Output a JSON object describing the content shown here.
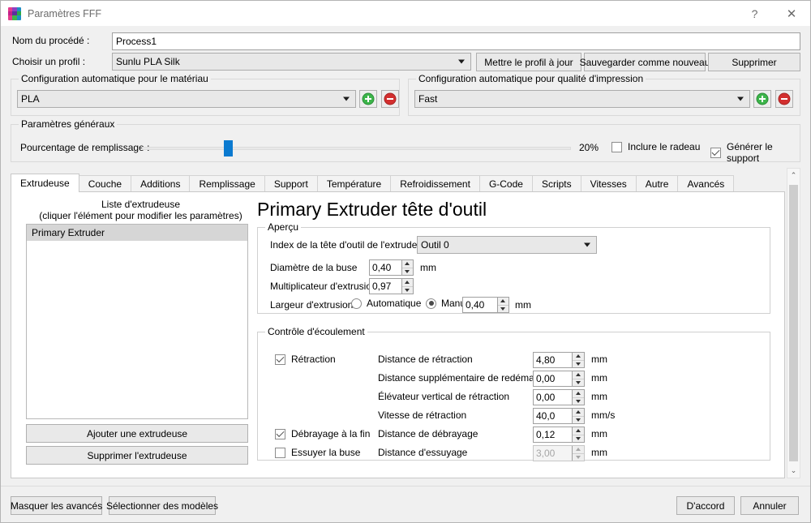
{
  "window": {
    "title": "Paramètres FFF",
    "help_label": "?",
    "close_label": "✕",
    "icon": "fff-settings-icon"
  },
  "top": {
    "process_name_label": "Nom du procédé :",
    "process_name_value": "Process1",
    "profile_label": "Choisir un profil :",
    "profile_value": "Sunlu PLA Silk",
    "update_profile_button": "Mettre le profil à jour",
    "save_as_new_button": "Sauvegarder comme nouveau",
    "delete_button": "Supprimer"
  },
  "material_group": {
    "title": "Configuration automatique pour le matériau",
    "value": "PLA",
    "add_label": "+",
    "remove_label": "−"
  },
  "quality_group": {
    "title": "Configuration automatique pour qualité d'impression",
    "value": "Fast",
    "add_label": "+",
    "remove_label": "−"
  },
  "general_group": {
    "title": "Paramètres généraux",
    "infill_label": "Pourcentage de remplissage :",
    "infill_value": "20%",
    "infill_percent": 20,
    "raft_label": "Inclure le radeau",
    "raft_checked": false,
    "support_label": "Générer le support",
    "support_checked": true
  },
  "tabs": [
    {
      "label": "Extrudeuse",
      "active": true
    },
    {
      "label": "Couche",
      "active": false
    },
    {
      "label": "Additions",
      "active": false
    },
    {
      "label": "Remplissage",
      "active": false
    },
    {
      "label": "Support",
      "active": false
    },
    {
      "label": "Température",
      "active": false
    },
    {
      "label": "Refroidissement",
      "active": false
    },
    {
      "label": "G-Code",
      "active": false
    },
    {
      "label": "Scripts",
      "active": false
    },
    {
      "label": "Vitesses",
      "active": false
    },
    {
      "label": "Autre",
      "active": false
    },
    {
      "label": "Avancés",
      "active": false
    }
  ],
  "extruder_list": {
    "title_line1": "Liste d'extrudeuse",
    "title_line2": "(cliquer l'élément pour modifier les paramètres)",
    "items": [
      "Primary Extruder"
    ],
    "selected": "Primary Extruder",
    "add_button": "Ajouter une extrudeuse",
    "remove_button": "Supprimer l'extrudeuse"
  },
  "panel": {
    "heading": "Primary Extruder tête d'outil",
    "overview": {
      "title": "Aperçu",
      "tool_index_label": "Index de la tête d'outil de l'extrudeuse",
      "tool_index_value": "Outil 0",
      "nozzle_diameter_label": "Diamètre de la buse",
      "nozzle_diameter_value": "0,40",
      "nozzle_diameter_unit": "mm",
      "extrusion_multiplier_label": "Multiplicateur d'extrusion",
      "extrusion_multiplier_value": "0,97",
      "extrusion_width_label": "Largeur d'extrusion",
      "extrusion_width_auto_label": "Automatique",
      "extrusion_width_manual_label": "Manuel",
      "extrusion_width_mode": "manuel",
      "extrusion_width_value": "0,40",
      "extrusion_width_unit": "mm"
    },
    "flow": {
      "title": "Contrôle d'écoulement",
      "retraction_label": "Rétraction",
      "retraction_checked": true,
      "coast_label": "Débrayage à la fin",
      "coast_checked": true,
      "wipe_label": "Essuyer la buse",
      "wipe_checked": false,
      "rows": [
        {
          "label": "Distance de rétraction",
          "value": "4,80",
          "unit": "mm",
          "disabled": false
        },
        {
          "label": "Distance supplémentaire de redémarrage",
          "value": "0,00",
          "unit": "mm",
          "disabled": false
        },
        {
          "label": "Élévateur vertical de rétraction",
          "value": "0,00",
          "unit": "mm",
          "disabled": false
        },
        {
          "label": "Vitesse de rétraction",
          "value": "40,0",
          "unit": "mm/s",
          "disabled": false
        },
        {
          "label": "Distance de débrayage",
          "value": "0,12",
          "unit": "mm",
          "disabled": false
        },
        {
          "label": "Distance d'essuyage",
          "value": "3,00",
          "unit": "mm",
          "disabled": true
        }
      ]
    }
  },
  "footer": {
    "hide_advanced_button": "Masquer les avancés",
    "select_models_button": "Sélectionner des modèles",
    "ok_button": "D'accord",
    "cancel_button": "Annuler"
  },
  "colors": {
    "accent_blue": "#0b7ad0",
    "add_green": "#3cb54a",
    "remove_red": "#d32f2f",
    "window_bg": "#f0f0f0"
  }
}
